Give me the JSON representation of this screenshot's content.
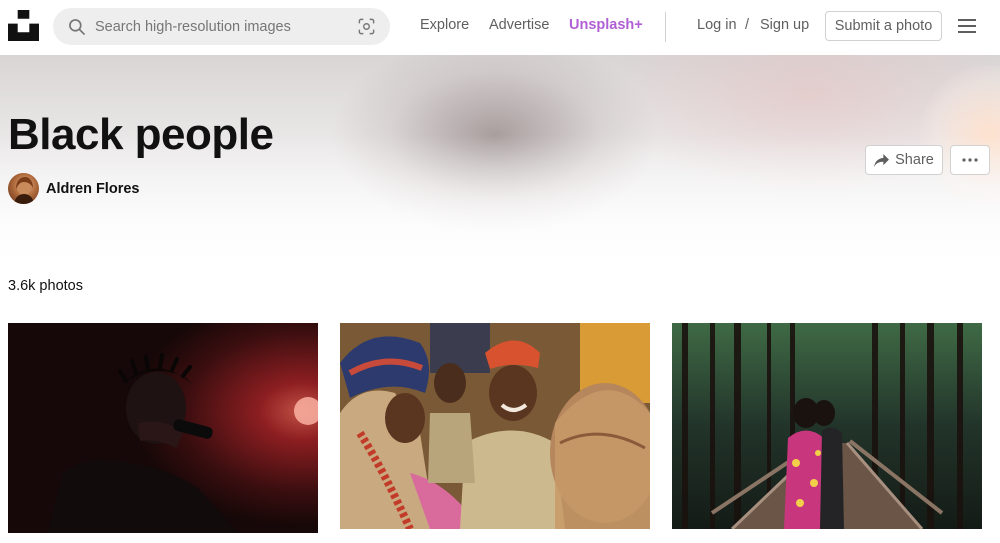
{
  "header": {
    "logo_icon": "unsplash-logo-icon",
    "search": {
      "placeholder": "Search high-resolution images",
      "value": "",
      "search_icon": "search-icon",
      "visual_search_icon": "visual-search-icon"
    },
    "nav": {
      "explore": "Explore",
      "advertise": "Advertise",
      "unsplash_plus": "Unsplash+",
      "login": "Log in",
      "separator": "/",
      "signup": "Sign up"
    },
    "submit_label": "Submit a photo",
    "menu_icon": "hamburger-menu-icon"
  },
  "collection": {
    "title": "Black people",
    "author": "Aldren Flores",
    "share_label": "Share",
    "share_icon": "share-arrow-icon",
    "more_icon": "ellipsis-icon",
    "photo_count": "3.6k photos"
  },
  "colors": {
    "unsplash_plus": "#b15fd4",
    "text_primary": "#111111",
    "text_secondary": "#5f5f5f",
    "border": "#d1d1d1",
    "search_bg": "#eeeeee"
  }
}
